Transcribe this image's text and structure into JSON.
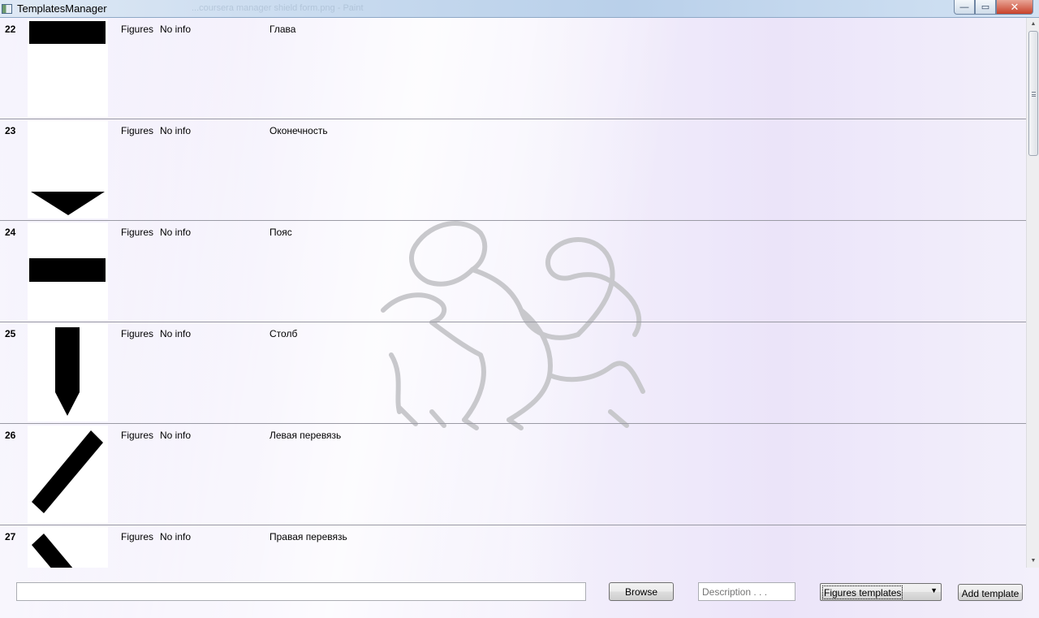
{
  "window": {
    "title": "TemplatesManager",
    "ghost_title": "...coursera manager shield form.png - Paint",
    "minimize_glyph": "—",
    "maximize_glyph": "▭",
    "close_glyph": "✕"
  },
  "rows": [
    {
      "num": "22",
      "category": "Figures",
      "info": "No info",
      "name": "Глава",
      "icon": "chief-figure-icon"
    },
    {
      "num": "23",
      "category": "Figures",
      "info": "No info",
      "name": "Оконечность",
      "icon": "base-figure-icon"
    },
    {
      "num": "24",
      "category": "Figures",
      "info": "No info",
      "name": "Пояс",
      "icon": "fess-figure-icon"
    },
    {
      "num": "25",
      "category": "Figures",
      "info": "No info",
      "name": "Столб",
      "icon": "pale-figure-icon"
    },
    {
      "num": "26",
      "category": "Figures",
      "info": "No info",
      "name": "Левая перевязь",
      "icon": "bend-sinister-figure-icon"
    },
    {
      "num": "27",
      "category": "Figures",
      "info": "No info",
      "name": "Правая перевязь",
      "icon": "bend-figure-icon"
    }
  ],
  "scrollbar": {
    "up_glyph": "▲",
    "down_glyph": "▼"
  },
  "bottom": {
    "path_value": "",
    "browse_label": "Browse",
    "description_placeholder": "Description . . .",
    "select_value": "Figures templates",
    "select_arrow": "▼",
    "add_label": "Add template"
  },
  "colors": {
    "figure": "#000000",
    "watermark": "#c8c8cc"
  }
}
